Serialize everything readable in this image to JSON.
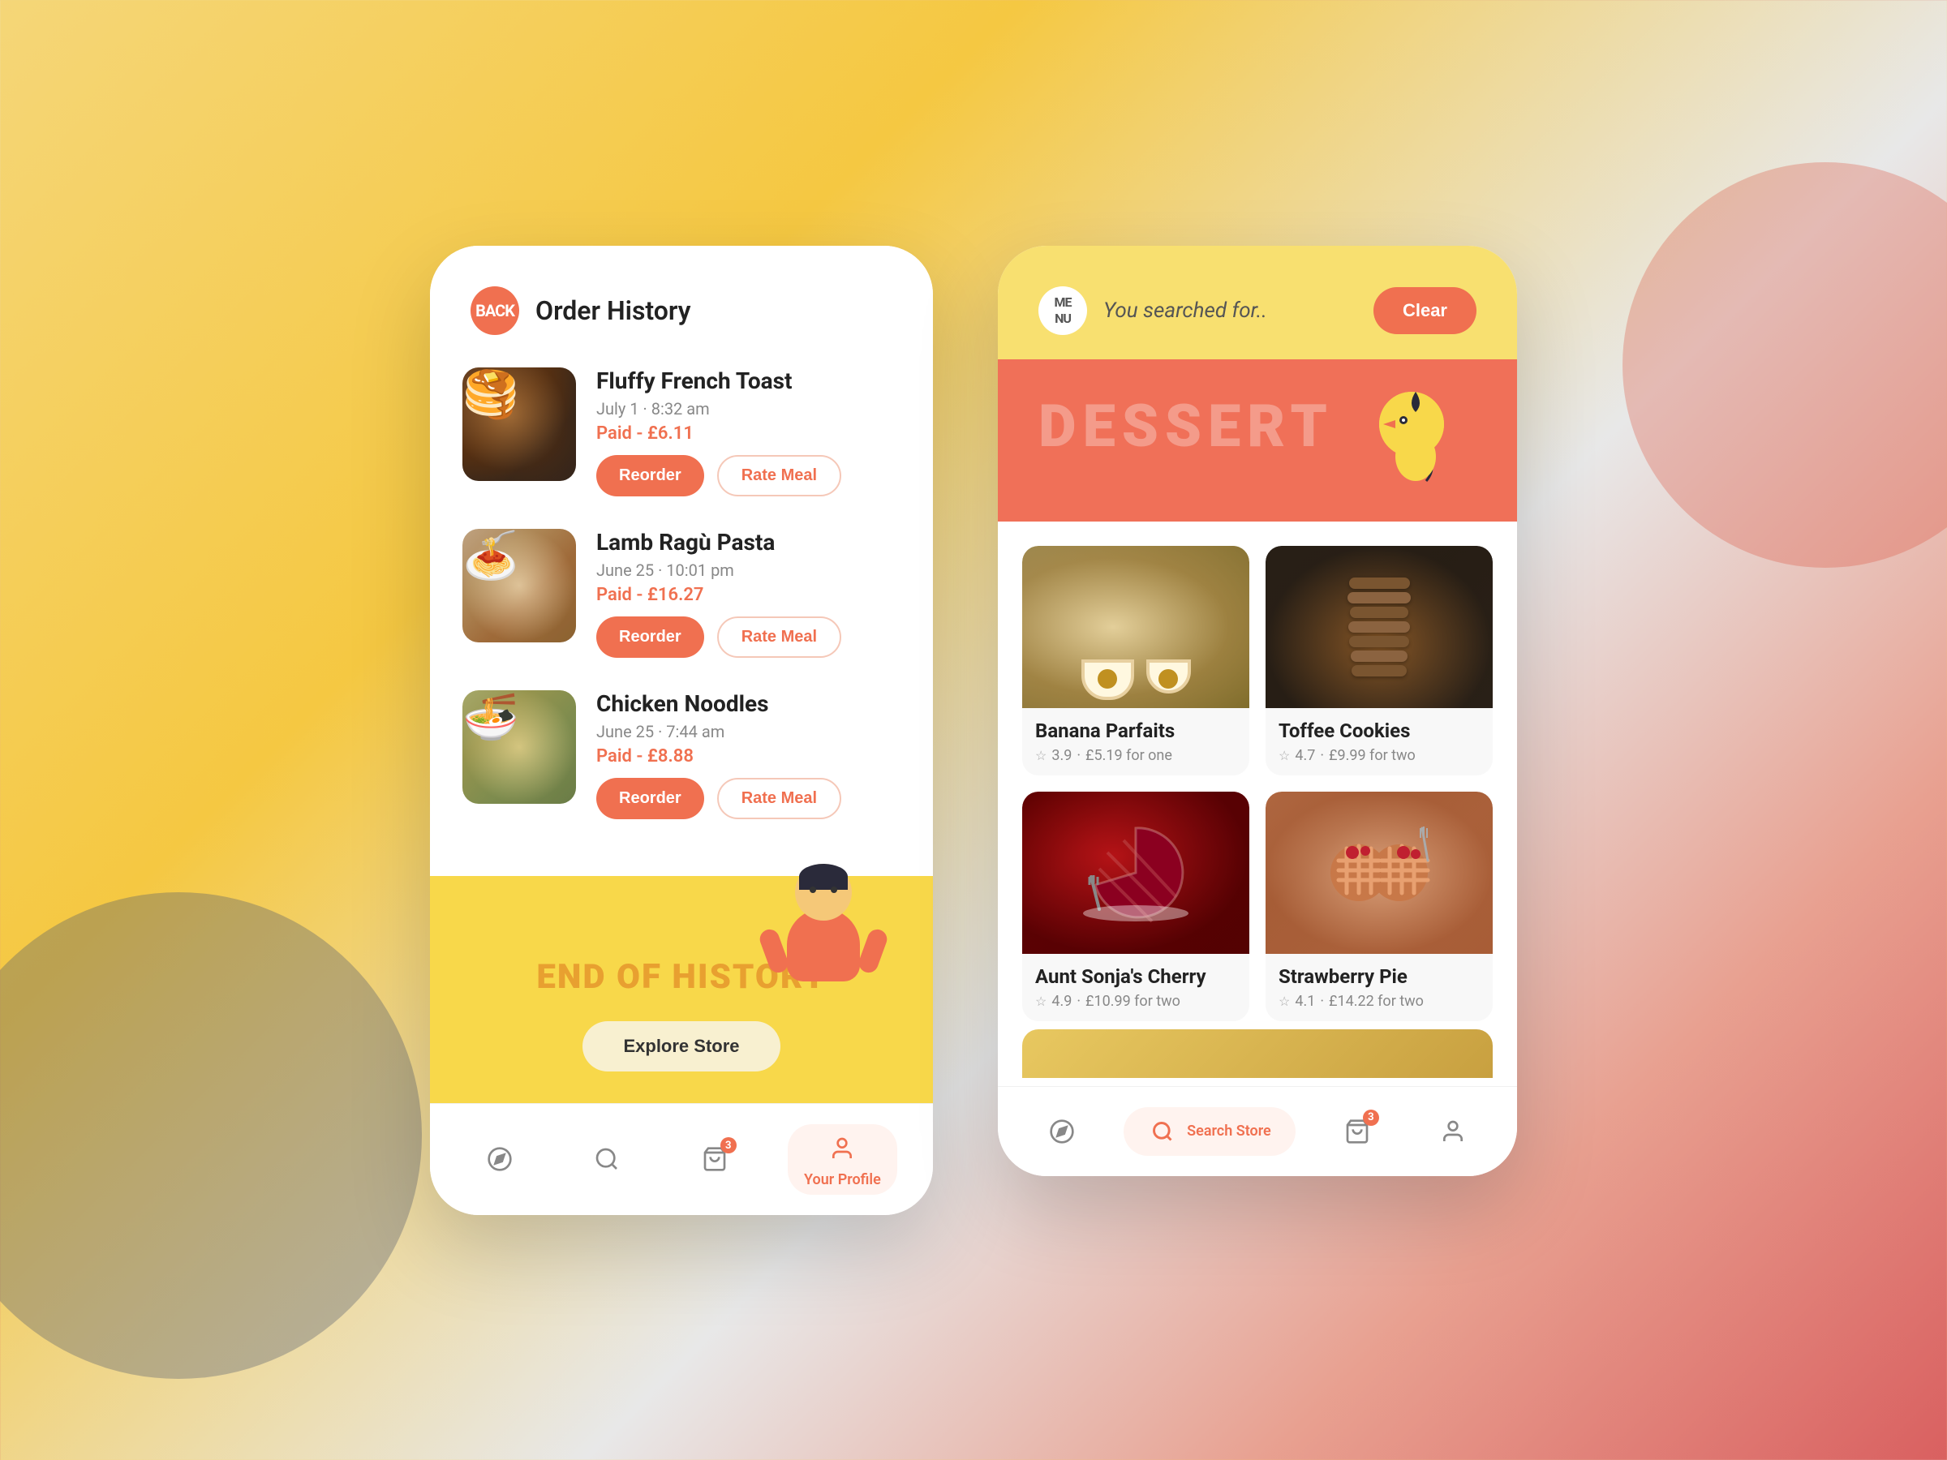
{
  "background": {
    "colors": [
      "#f5d678",
      "#f5c842",
      "#e8e8e8",
      "#e8a090",
      "#d96060"
    ]
  },
  "left_phone": {
    "header": {
      "back_label": "BACK",
      "title": "Order History"
    },
    "orders": [
      {
        "id": "order-1",
        "name": "Fluffy French Toast",
        "date": "July 1 · 8:32 am",
        "status": "Paid",
        "price": "£6.11",
        "paid_text": "Paid - £6.11",
        "emoji": "🍞",
        "img_class": "french-toast",
        "reorder_label": "Reorder",
        "rate_label": "Rate Meal"
      },
      {
        "id": "order-2",
        "name": "Lamb Ragù Pasta",
        "date": "June 25 · 10:01 pm",
        "status": "Paid",
        "price": "£16.27",
        "paid_text": "Paid - £16.27",
        "emoji": "🍝",
        "img_class": "lamb-pasta",
        "reorder_label": "Reorder",
        "rate_label": "Rate Meal"
      },
      {
        "id": "order-3",
        "name": "Chicken Noodles",
        "date": "June 25 · 7:44 am",
        "status": "Paid",
        "price": "£8.88",
        "paid_text": "Paid - £8.88",
        "emoji": "🍜",
        "img_class": "chicken-noodles",
        "reorder_label": "Reorder",
        "rate_label": "Rate Meal"
      }
    ],
    "end_section": {
      "text": "END OF HISTORY",
      "explore_label": "Explore Store"
    },
    "bottom_nav": [
      {
        "id": "nav-compass",
        "icon": "🧭",
        "label": "",
        "active": false
      },
      {
        "id": "nav-search",
        "icon": "🔍",
        "label": "",
        "active": false
      },
      {
        "id": "nav-bag",
        "icon": "🛍",
        "label": "",
        "active": false,
        "badge": "3"
      },
      {
        "id": "nav-profile",
        "icon": "👤",
        "label": "Your Profile",
        "active": true
      }
    ]
  },
  "right_phone": {
    "header": {
      "menu_label": "ME\nNU",
      "search_placeholder": "You searched for..",
      "clear_label": "Clear"
    },
    "banner": {
      "text": "DESSERT"
    },
    "foods": [
      {
        "id": "food-1",
        "name": "Banana Parfaits",
        "rating": "3.9",
        "price_text": "£5.19 for one",
        "img_class": "img-banana",
        "emoji": "🍮",
        "position": "top-left"
      },
      {
        "id": "food-2",
        "name": "Toffee Cookies",
        "rating": "4.7",
        "price_text": "£9.99 for two",
        "img_class": "img-toffee",
        "emoji": "🍪",
        "position": "top-right"
      },
      {
        "id": "food-3",
        "name": "Aunt Sonja's Cherry",
        "rating": "4.9",
        "price_text": "£10.99 for two",
        "img_class": "img-cherry",
        "emoji": "🥧",
        "position": "bottom-left"
      },
      {
        "id": "food-4",
        "name": "Strawberry Pie",
        "rating": "4.1",
        "price_text": "£14.22 for two",
        "img_class": "img-strawberry",
        "emoji": "🥧",
        "position": "bottom-right"
      }
    ],
    "bottom_nav": [
      {
        "id": "nav-compass-r",
        "icon": "🧭",
        "label": "",
        "active": false
      },
      {
        "id": "nav-search-r",
        "icon": "🔍",
        "label": "Search Store",
        "active": true
      },
      {
        "id": "nav-bag-r",
        "icon": "🛍",
        "label": "",
        "active": false,
        "badge": "3"
      },
      {
        "id": "nav-profile-r",
        "icon": "👤",
        "label": "",
        "active": false
      }
    ]
  },
  "colors": {
    "primary": "#f07050",
    "accent_yellow": "#f8d84a",
    "text_dark": "#222222",
    "text_muted": "#888888"
  }
}
